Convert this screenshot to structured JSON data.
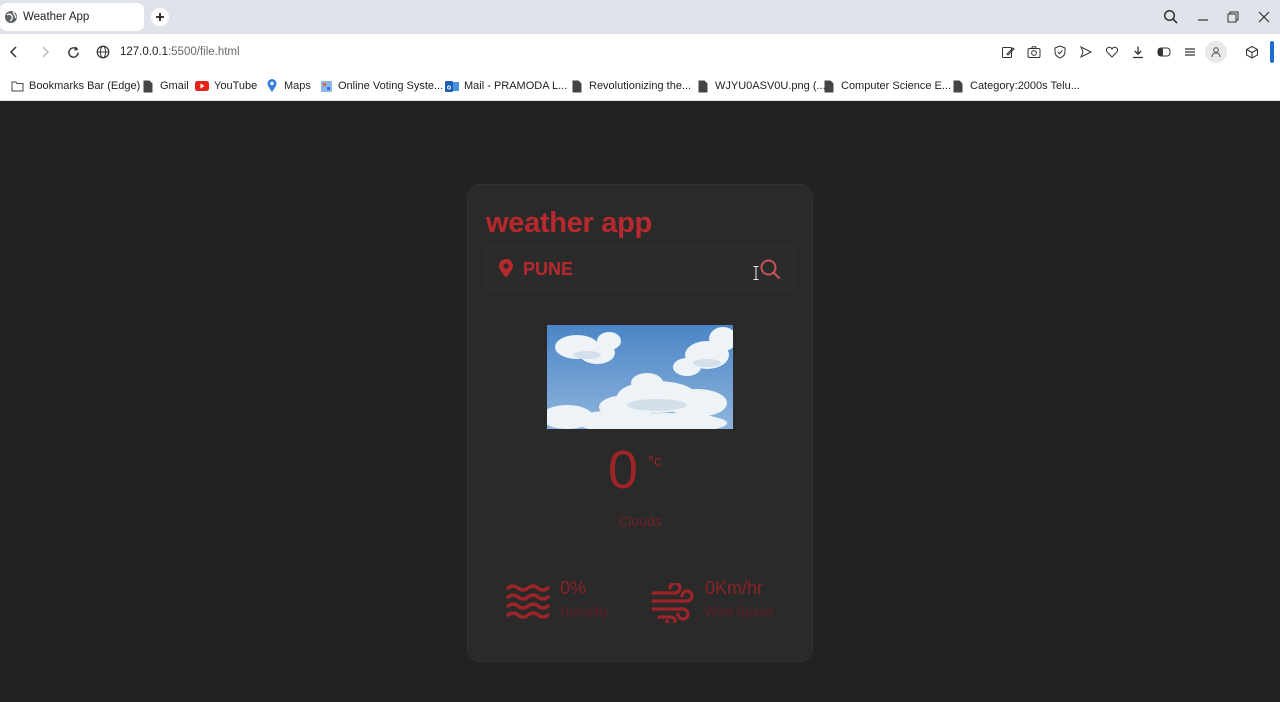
{
  "browser": {
    "tab_title": "Weather App",
    "url_host": "127.0.0.1",
    "url_rest": ":5500/file.html"
  },
  "bookmarks": [
    {
      "label": "Bookmarks Bar (Edge)",
      "icon": "folder-icon"
    },
    {
      "label": "Gmail",
      "icon": "page-icon"
    },
    {
      "label": "YouTube",
      "icon": "youtube-icon"
    },
    {
      "label": "Maps",
      "icon": "maps-pin-icon"
    },
    {
      "label": "Online Voting Syste...",
      "icon": "voting-icon"
    },
    {
      "label": "Mail - PRAMODA L...",
      "icon": "outlook-icon"
    },
    {
      "label": "Revolutionizing the...",
      "icon": "page-icon"
    },
    {
      "label": "WJYU0ASV0U.png (...",
      "icon": "page-icon"
    },
    {
      "label": "Computer Science E...",
      "icon": "page-icon"
    },
    {
      "label": "Category:2000s Telu...",
      "icon": "page-icon"
    }
  ],
  "app": {
    "title": "weather app",
    "search_value": "PUNE",
    "temperature": "0",
    "unit": "°c",
    "condition": "Clouds",
    "humidity_value": "0%",
    "humidity_label": "Humidity",
    "wind_value": "0Km/hr",
    "wind_label": "Wind Speed",
    "weather_image": "clouds-image"
  },
  "colors": {
    "accent": "#b8292d",
    "background": "#222224",
    "card": "#2a2a2b"
  }
}
